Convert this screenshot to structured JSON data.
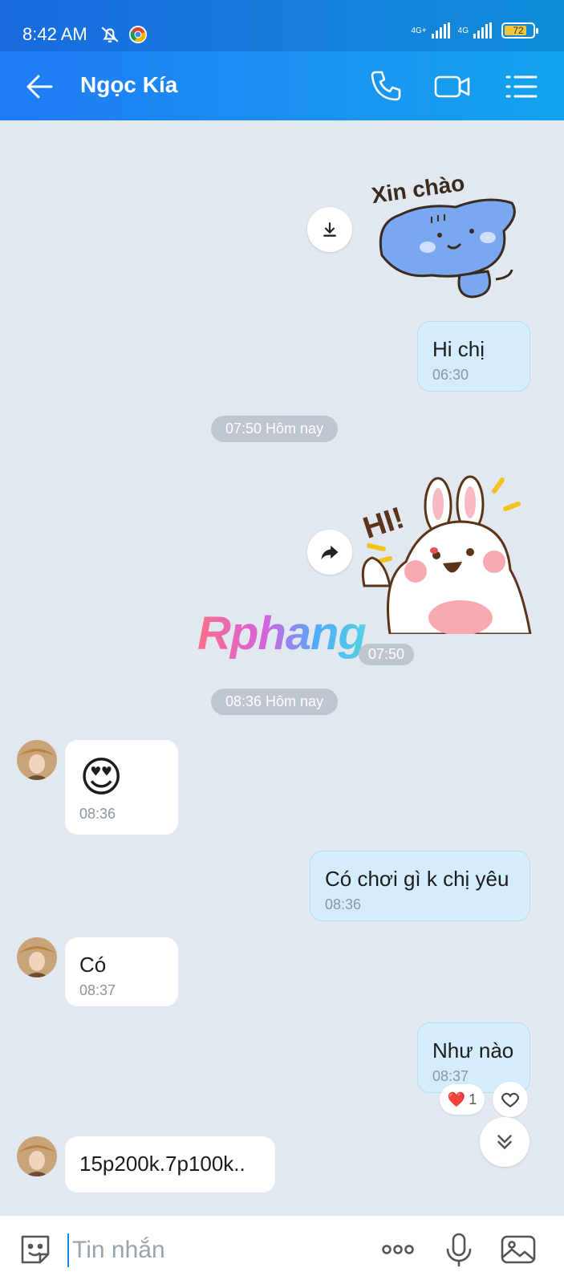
{
  "status_bar": {
    "time": "8:42 AM",
    "net1": "4G+",
    "net2": "4G",
    "battery": "72"
  },
  "header": {
    "contact_name": "Ngọc Kía"
  },
  "stickers": {
    "hello_text": "Xin chào",
    "hi_text": "HI!"
  },
  "messages": [
    {
      "dir": "out",
      "text": "Hi chị",
      "time": "06:30"
    },
    {
      "dir": "in",
      "text": "😍",
      "time": "08:36"
    },
    {
      "dir": "out",
      "text": "Có chơi gì k chị yêu",
      "time": "08:36"
    },
    {
      "dir": "in",
      "text": "Có",
      "time": "08:37"
    },
    {
      "dir": "out",
      "text": "Như nào",
      "time": "08:37"
    },
    {
      "dir": "in",
      "text": "15p200k.7p100k..",
      "time": ""
    }
  ],
  "dividers": [
    "07:50 Hôm nay",
    "08:36 Hôm nay"
  ],
  "sticker_time": "07:50",
  "reaction": {
    "emoji": "❤️",
    "count": "1"
  },
  "watermark": "Rphang",
  "input": {
    "placeholder": "Tin nhắn"
  },
  "colors": {
    "header_gradient_start": "#1f7af5",
    "header_gradient_end": "#12a3ee",
    "chat_bg": "#e2e8ef",
    "out_bubble": "#d4ecfb",
    "in_bubble": "#ffffff"
  }
}
